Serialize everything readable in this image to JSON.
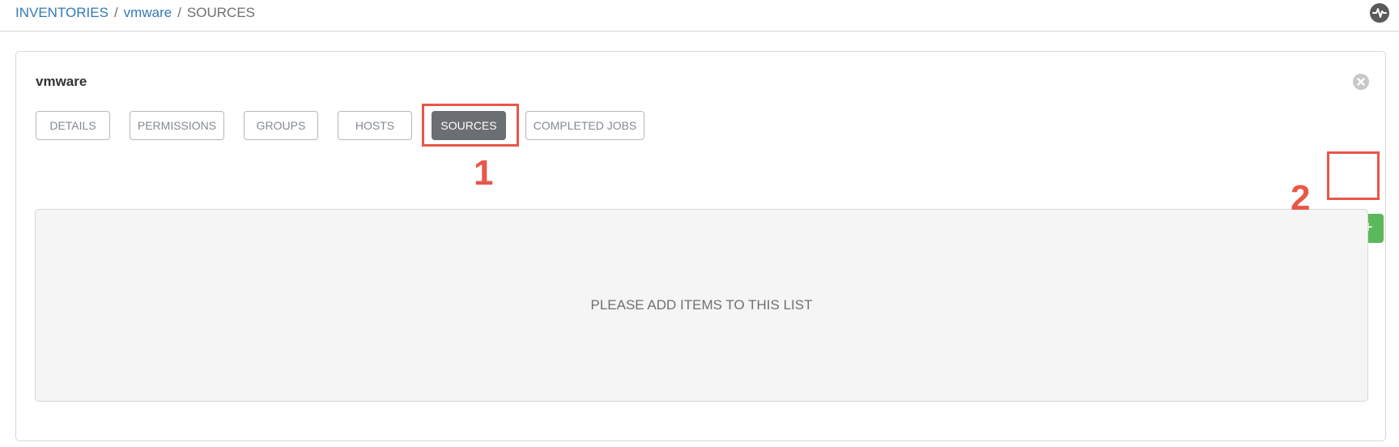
{
  "breadcrumb": {
    "items": [
      "INVENTORIES",
      "vmware",
      "SOURCES"
    ],
    "separator": "/"
  },
  "header": {
    "activity_icon": "activity-stream-icon"
  },
  "panel": {
    "title": "vmware",
    "close_icon": "close-icon",
    "tabs": [
      {
        "label": "DETAILS",
        "active": false
      },
      {
        "label": "PERMISSIONS",
        "active": false
      },
      {
        "label": "GROUPS",
        "active": false
      },
      {
        "label": "HOSTS",
        "active": false
      },
      {
        "label": "SOURCES",
        "active": true
      },
      {
        "label": "COMPLETED JOBS",
        "active": false
      }
    ],
    "add_button_label": "+",
    "empty_message": "PLEASE ADD ITEMS TO THIS LIST"
  },
  "annotations": {
    "callout_1": "1",
    "callout_2": "2",
    "color": "#e8574a"
  },
  "colors": {
    "link": "#337ab7",
    "active_tab": "#6b6e72",
    "add_button": "#5cb85c"
  }
}
